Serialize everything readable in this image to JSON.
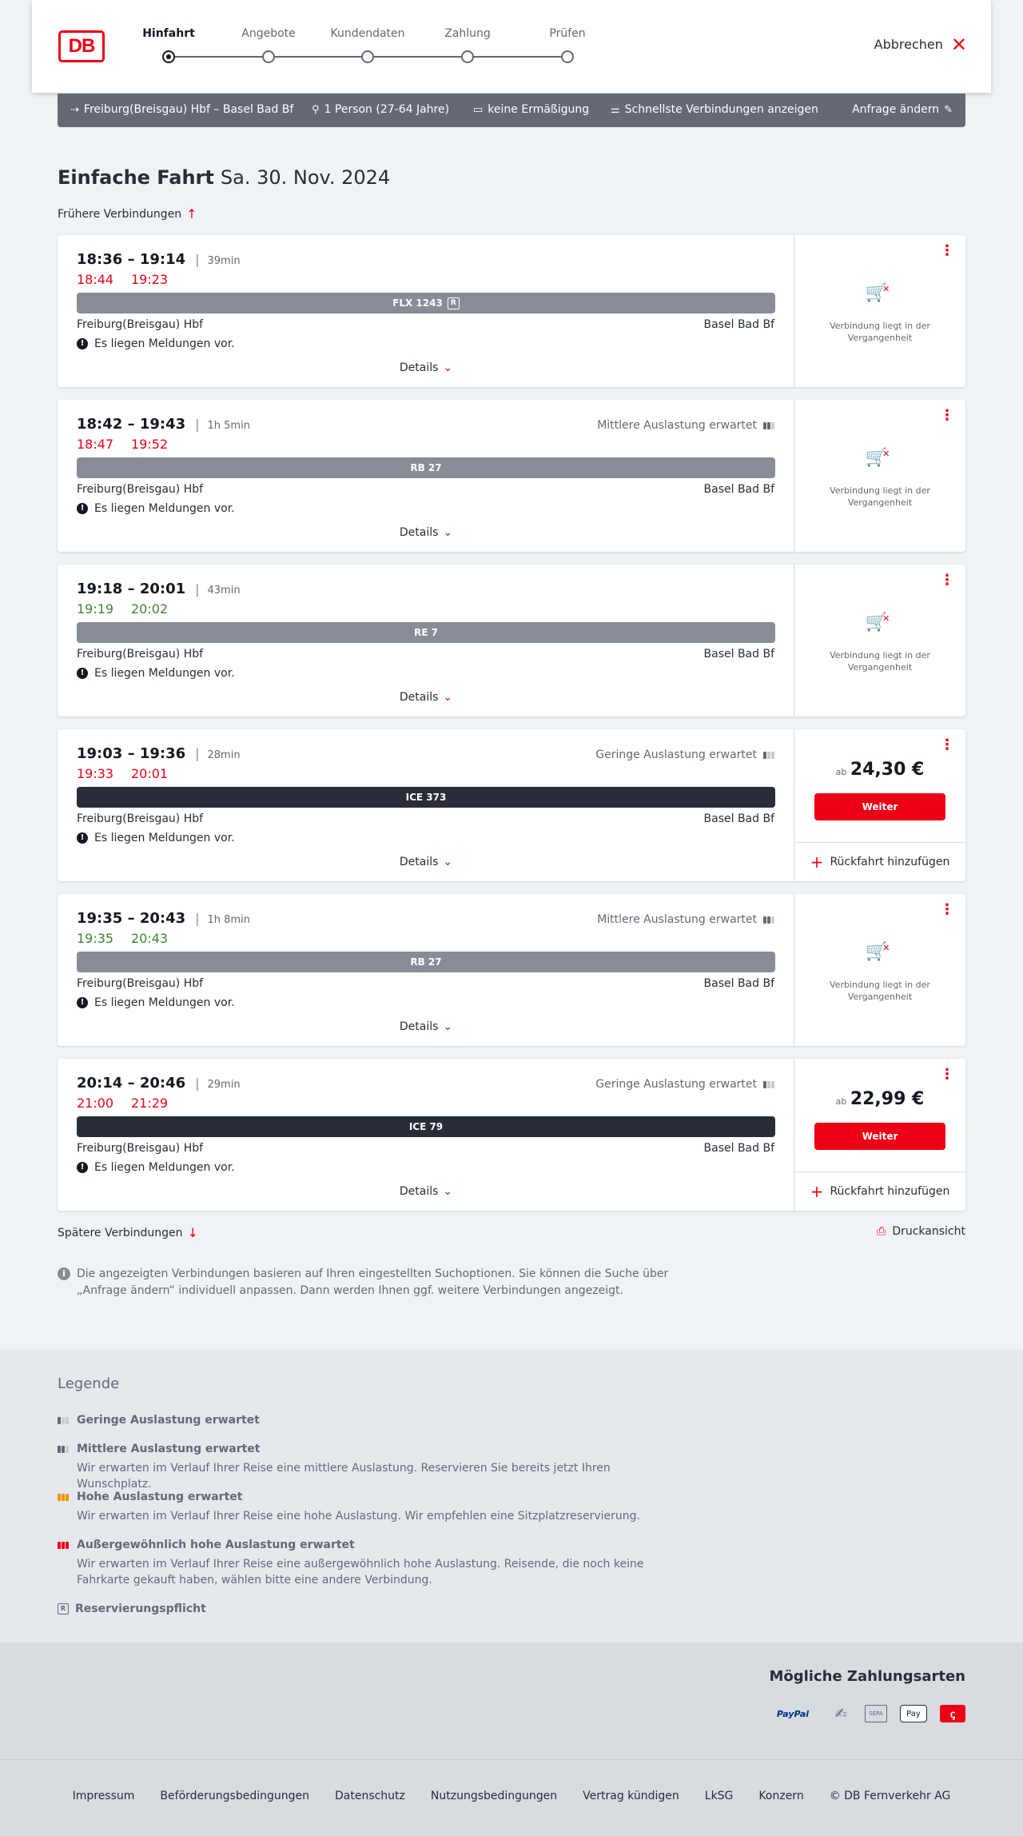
{
  "header": {
    "logo": "DB",
    "steps": [
      {
        "label": "Hinfahrt",
        "active": true
      },
      {
        "label": "Angebote",
        "active": false
      },
      {
        "label": "Kundendaten",
        "active": false
      },
      {
        "label": "Zahlung",
        "active": false
      },
      {
        "label": "Prüfen",
        "active": false
      }
    ],
    "cancel_label": "Abbrechen"
  },
  "searchbar": {
    "route": "Freiburg(Breisgau) Hbf – Basel Bad Bf",
    "passengers": "1 Person (27-64 Jahre)",
    "discount": "keine Ermäßigung",
    "fastest": "Schnellste Verbindungen anzeigen",
    "change": "Anfrage ändern"
  },
  "headline": {
    "title": "Einfache Fahrt",
    "date": "Sa. 30. Nov. 2024"
  },
  "earlier_label": "Frühere Verbindungen",
  "later_label": "Spätere Verbindungen",
  "connections": [
    {
      "times": "18:36 – 19:14",
      "duration": "39min",
      "rt_dep": "18:44",
      "rt_arr": "19:23",
      "rt_status": "late",
      "load": "",
      "train": "FLX 1243",
      "train_style": "grey",
      "reservation": "R",
      "from": "Freiburg(Breisgau) Hbf",
      "to": "Basel Bad Bf",
      "message": "Es liegen Meldungen vor.",
      "details": "Details",
      "past": "Verbindung liegt in der Vergangenheit"
    },
    {
      "times": "18:42 – 19:43",
      "duration": "1h 5min",
      "rt_dep": "18:47",
      "rt_arr": "19:52",
      "rt_status": "late",
      "load": "Mittlere Auslastung erwartet",
      "train": "RB 27",
      "train_style": "grey",
      "from": "Freiburg(Breisgau) Hbf",
      "to": "Basel Bad Bf",
      "message": "Es liegen Meldungen vor.",
      "details": "Details",
      "past": "Verbindung liegt in der Vergangenheit"
    },
    {
      "times": "19:18 – 20:01",
      "duration": "43min",
      "rt_dep": "19:19",
      "rt_arr": "20:02",
      "rt_status": "ontime",
      "load": "",
      "train": "RE 7",
      "train_style": "grey",
      "from": "Freiburg(Breisgau) Hbf",
      "to": "Basel Bad Bf",
      "message": "Es liegen Meldungen vor.",
      "details": "Details",
      "past": "Verbindung liegt in der Vergangenheit"
    },
    {
      "times": "19:03 – 19:36",
      "duration": "28min",
      "rt_dep": "19:33",
      "rt_arr": "20:01",
      "rt_status": "late",
      "load": "Geringe Auslastung erwartet",
      "train": "ICE 373",
      "train_style": "dark",
      "from": "Freiburg(Breisgau) Hbf",
      "to": "Basel Bad Bf",
      "message": "Es liegen Meldungen vor.",
      "details": "Details",
      "price_prefix": "ab",
      "price": "24,30 €",
      "button": "Weiter",
      "return": "Rückfahrt hinzufügen"
    },
    {
      "times": "19:35 – 20:43",
      "duration": "1h 8min",
      "rt_dep": "19:35",
      "rt_arr": "20:43",
      "rt_status": "ontime",
      "load": "Mittlere Auslastung erwartet",
      "train": "RB 27",
      "train_style": "grey",
      "from": "Freiburg(Breisgau) Hbf",
      "to": "Basel Bad Bf",
      "message": "Es liegen Meldungen vor.",
      "details": "Details",
      "past": "Verbindung liegt in der Vergangenheit"
    },
    {
      "times": "20:14 – 20:46",
      "duration": "29min",
      "rt_dep": "21:00",
      "rt_arr": "21:29",
      "rt_status": "late",
      "load": "Geringe Auslastung erwartet",
      "train": "ICE 79",
      "train_style": "dark",
      "from": "Freiburg(Breisgau) Hbf",
      "to": "Basel Bad Bf",
      "message": "Es liegen Meldungen vor.",
      "details": "Details",
      "price_prefix": "ab",
      "price": "22,99 €",
      "button": "Weiter",
      "return": "Rückfahrt hinzufügen"
    }
  ],
  "print_label": "Druckansicht",
  "info_text": "Die angezeigten Verbindungen basieren auf Ihren eingestellten Suchoptionen. Sie können die Suche über „Anfrage ändern“ individuell anpassen. Dann werden Ihnen ggf. weitere Verbindungen angezeigt.",
  "legend": {
    "title": "Legende",
    "items": [
      {
        "title": "Geringe Auslastung erwartet",
        "desc": ""
      },
      {
        "title": "Mittlere Auslastung erwartet",
        "desc": "Wir erwarten im Verlauf Ihrer Reise eine mittlere Auslastung. Reservieren Sie bereits jetzt Ihren Wunschplatz."
      },
      {
        "title": "Hohe Auslastung erwartet",
        "desc": "Wir erwarten im Verlauf Ihrer Reise eine hohe Auslastung. Wir empfehlen eine Sitzplatzreservierung."
      },
      {
        "title": "Außergewöhnlich hohe Auslastung erwartet",
        "desc": "Wir erwarten im Verlauf Ihrer Reise eine außergewöhnlich hohe Auslastung. Reisende, die noch keine Fahrkarte gekauft haben, wählen bitte eine andere Verbindung."
      },
      {
        "title": "Reservierungspflicht",
        "desc": ""
      }
    ],
    "reservation_symbol": "R"
  },
  "payment": {
    "title": "Mögliche Zahlungsarten",
    "paypal": "PayPal",
    "sepa": "SEPA",
    "applepay": "Pay"
  },
  "footer": {
    "links": [
      "Impressum",
      "Beförderungsbedingungen",
      "Datenschutz",
      "Nutzungsbedingungen",
      "Vertrag kündigen",
      "LkSG",
      "Konzern",
      "© DB Fernverkehr AG"
    ]
  },
  "colors": {
    "brand_red": "#ec0016",
    "late": "#ec0016",
    "ontime": "#408335",
    "searchbar": "#646973"
  }
}
